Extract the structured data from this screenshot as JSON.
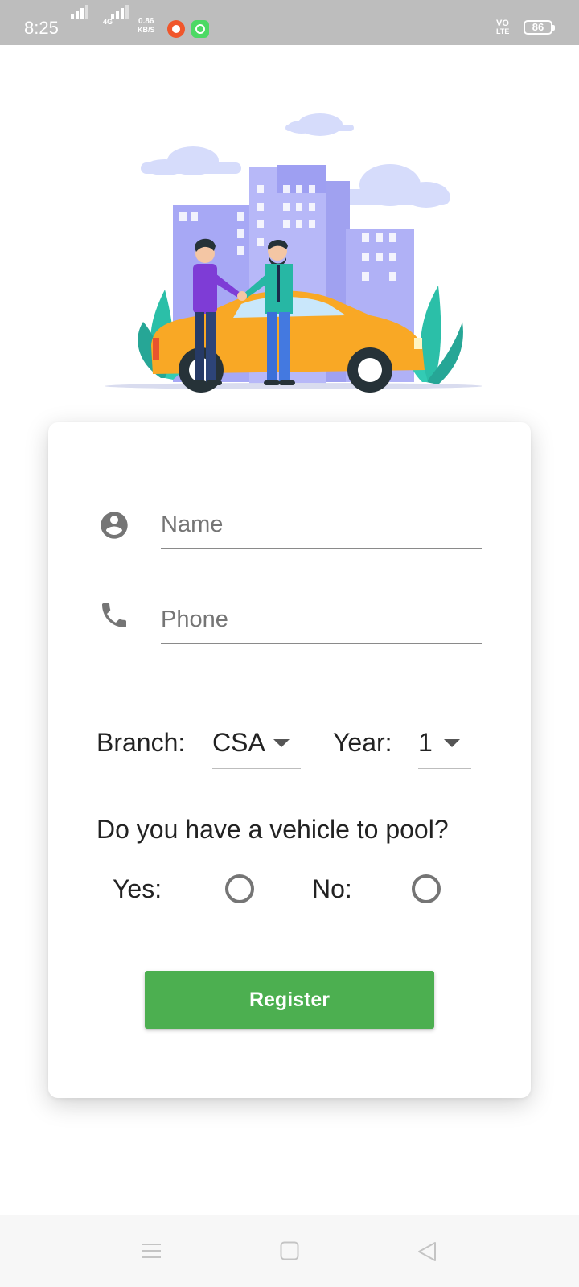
{
  "status_bar": {
    "time": "8:25",
    "network_speed_value": "0.86",
    "network_speed_unit": "KB/S",
    "network_type": "4G",
    "volte_line1": "VO",
    "volte_line2": "LTE",
    "battery_level": "86"
  },
  "form": {
    "name_placeholder": "Name",
    "phone_placeholder": "Phone",
    "branch_label": "Branch:",
    "branch_value": "CSA",
    "year_label": "Year:",
    "year_value": "1",
    "vehicle_question": "Do you have a vehicle to pool?",
    "yes_label": "Yes:",
    "no_label": "No:",
    "register_label": "Register"
  },
  "colors": {
    "accent": "#4caf50",
    "status_bar": "#bdbdbd",
    "car": "#f9a825",
    "building": "#a7a8f5"
  },
  "icons": {
    "name_field": "account-circle-icon",
    "phone_field": "phone-icon",
    "dropdown": "arrow-drop-down-icon",
    "nav_menu": "menu-icon",
    "nav_home": "square-home-icon",
    "nav_back": "triangle-back-icon"
  }
}
